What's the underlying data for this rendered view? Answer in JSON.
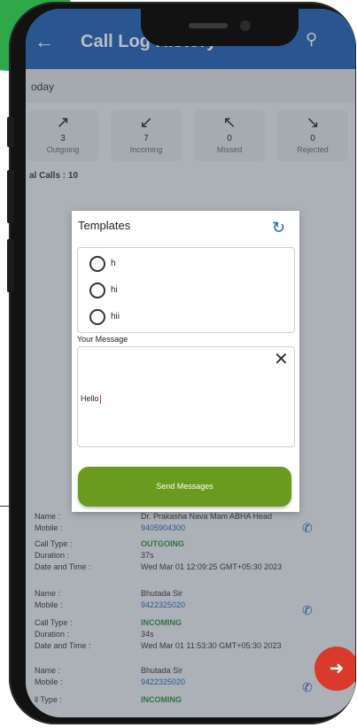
{
  "app": {
    "title": "Call Log History",
    "back_icon": "arrow-back-icon",
    "search_icon": "search-icon"
  },
  "colors": {
    "primary": "#1f5fb3",
    "send_button": "#6a9a1e",
    "fab": "#d93a2b",
    "accent_green": "#2fa84a"
  },
  "section_header": "oday",
  "stats": [
    {
      "icon": "↗",
      "count": "3",
      "label": "Outgoing"
    },
    {
      "icon": "↙",
      "count": "7",
      "label": "Incoming"
    },
    {
      "icon": "↖",
      "count": "0",
      "label": "Missed"
    },
    {
      "icon": "↘",
      "count": "0",
      "label": "Rejected"
    }
  ],
  "total_calls": "al Calls : 10",
  "logs": [
    {
      "name_label": "Name :",
      "name": "Dr. Prakasha Nava Mam ABHA Head",
      "mobile_label": "Mobile :",
      "mobile": "9405904300",
      "type_label": "Call Type :",
      "type": "OUTGOING",
      "duration_label": "Duration :",
      "duration": "37s",
      "datetime_label": "Date and Time :",
      "datetime": "Wed Mar 01 12:09:25 GMT+05:30 2023"
    },
    {
      "name_label": "Name :",
      "name": "Bhutada Sir",
      "mobile_label": "Mobile :",
      "mobile": "9422325020",
      "type_label": "Call Type :",
      "type": "INCOMING",
      "duration_label": "Duration :",
      "duration": "34s",
      "datetime_label": "Date and Time :",
      "datetime": "Wed Mar 01 11:53:30 GMT+05:30 2023"
    },
    {
      "name_label": "Name :",
      "name": "Bhutada Sir",
      "mobile_label": "Mobile :",
      "mobile": "9422325020",
      "type_label": "ll Type :",
      "type": "INCOMING"
    }
  ],
  "dialog": {
    "title": "Templates",
    "refresh_icon": "refresh-icon",
    "templates": [
      {
        "label": "h"
      },
      {
        "label": "hi"
      },
      {
        "label": "hii"
      }
    ],
    "message_label": "Your Message",
    "message_value": "Hello",
    "close_icon": "close-icon",
    "send_label": "Send Messages"
  },
  "fab_icon": "arrow-forward-icon"
}
